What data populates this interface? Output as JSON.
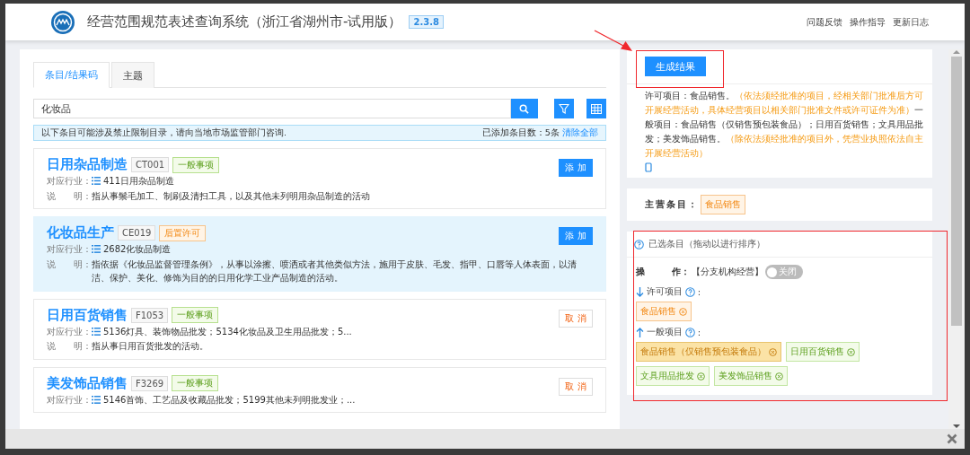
{
  "header": {
    "title": "经营范围规范表述查询系统（浙江省湖州市-试用版）",
    "version": "2.3.8",
    "links": [
      "问题反馈",
      "操作指导",
      "更新日志"
    ]
  },
  "tabs": [
    {
      "label": "条目/结果码",
      "selected": true
    },
    {
      "label": "主题",
      "selected": false
    }
  ],
  "search": {
    "value": "化妆品"
  },
  "notice": {
    "text": "以下条目可能涉及禁止限制目录，请向当地市场监管部门咨询.",
    "count": "已添加条目数：5条",
    "clear": "清除全部"
  },
  "items": [
    {
      "name": "日用杂品制造",
      "code": "CT001",
      "tag": "一般事项",
      "kind": "general",
      "industry_label": "对应行业：",
      "industry": "411日用杂品制造",
      "desc_label": "说　　明：",
      "desc": "指从事鬃毛加工、制刷及清扫工具，以及其他未列明用杂品制造的活动",
      "action": "添 加",
      "added": false,
      "highlighted": false
    },
    {
      "name": "化妆品生产",
      "code": "CE019",
      "tag": "后置许可",
      "kind": "permit",
      "industry_label": "对应行业：",
      "industry": "2682化妆品制造",
      "desc_label": "说　　明：",
      "desc": "指依据《化妆品监督管理条例》，从事以涂擦、喷洒或者其他类似方法，施用于皮肤、毛发、指甲、口唇等人体表面，以清洁、保护、美化、修饰为目的的日用化学工业产品制造的活动。",
      "action": "添 加",
      "added": false,
      "highlighted": true
    },
    {
      "name": "日用百货销售",
      "code": "F1053",
      "tag": "一般事项",
      "kind": "general",
      "industry_label": "对应行业：",
      "industry": "5136灯具、装饰物品批发；5134化妆品及卫生用品批发；5...",
      "desc_label": "说　　明：",
      "desc": "指从事日用百货批发的活动。",
      "action": "取 消",
      "added": true,
      "highlighted": false
    },
    {
      "name": "美发饰品销售",
      "code": "F3269",
      "tag": "一般事项",
      "kind": "general",
      "industry_label": "对应行业：",
      "industry": "5146首饰、工艺品及收藏品批发；5199其他未列明批发业；...",
      "action": "取 消",
      "added": true,
      "highlighted": false
    }
  ],
  "result": {
    "button": "生成结果",
    "segments": [
      {
        "kind": "normal",
        "text": "许可项目：食品销售。"
      },
      {
        "kind": "note",
        "text": "（依法须经批准的项目，经相关部门批准后方可开展经营活动，具体经营项目以相关部门批准文件或许可证件为准）"
      },
      {
        "kind": "normal",
        "text": "一般项目：食品销售（仅销售预包装食品）；日用百货销售；文具用品批发；美发饰品销售。"
      },
      {
        "kind": "note",
        "text": "（除依法须经批准的项目外，凭营业执照依法自主开展经营活动）"
      }
    ]
  },
  "main_item": {
    "label": "主营条目：",
    "tag": "食品销售"
  },
  "selected_panel": {
    "title": "已选条目（拖动以进行排序）",
    "op_label": "操　　　作：",
    "op_value": "【分支机构经营】",
    "toggle": {
      "on": false,
      "label": "关闭"
    },
    "groups": [
      {
        "kind": "permit",
        "title": "许可项目",
        "suffix": ":",
        "tags": [
          {
            "label": "食品销售",
            "highlighted": false
          }
        ]
      },
      {
        "kind": "general",
        "title": "一般项目",
        "suffix": ":",
        "tags": [
          {
            "label": "食品销售（仅销售预包装食品）",
            "highlighted": true
          },
          {
            "label": "日用百货销售",
            "highlighted": false
          },
          {
            "label": "文具用品批发",
            "highlighted": false
          },
          {
            "label": "美发饰品销售",
            "highlighted": false
          }
        ]
      }
    ]
  }
}
